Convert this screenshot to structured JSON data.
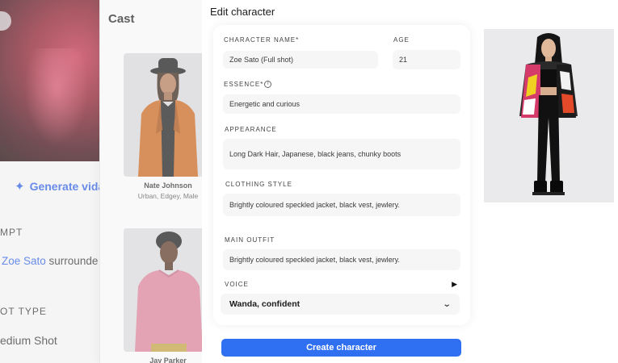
{
  "background": {
    "generate_video_label": "Generate vida",
    "prompt_label": "MPT",
    "prompt_highlight": "Zoe Sato",
    "prompt_rest": " surrounde",
    "shot_type_label": "OT TYPE",
    "shot_type_value": "edium Shot"
  },
  "cast": {
    "title": "Cast",
    "members": [
      {
        "name": "Nate Johnson",
        "tags": "Urban, Edgey, Male"
      },
      {
        "name": "Jay Parker",
        "tags": ""
      }
    ]
  },
  "dialog": {
    "title": "Edit character",
    "character_name": {
      "label": "CHARACTER NAME*",
      "value": "Zoe Sato (Full shot)"
    },
    "age": {
      "label": "AGE",
      "value": "21"
    },
    "essence": {
      "label": "ESSENCE*",
      "value": "Energetic and curious"
    },
    "appearance": {
      "label": "APPEARANCE",
      "value": "Long Dark Hair, Japanese, black jeans, chunky boots"
    },
    "clothing_style": {
      "label": "CLOTHING STYLE",
      "value": "Brightly coloured speckled jacket, black vest, jewlery."
    },
    "main_outfit": {
      "label": "MAIN OUTFIT",
      "value": "Brightly coloured speckled jacket, black vest, jewlery."
    },
    "voice": {
      "label": "VOICE",
      "value": "Wanda, confident"
    },
    "create_label": "Create character"
  },
  "icons": {
    "info": "info-icon",
    "play": "play-icon",
    "chevron": "chevron-down-icon",
    "sparkle": "sparkle-icon"
  },
  "colors": {
    "accent": "#2f6ff2",
    "link": "#2f5fe0"
  }
}
